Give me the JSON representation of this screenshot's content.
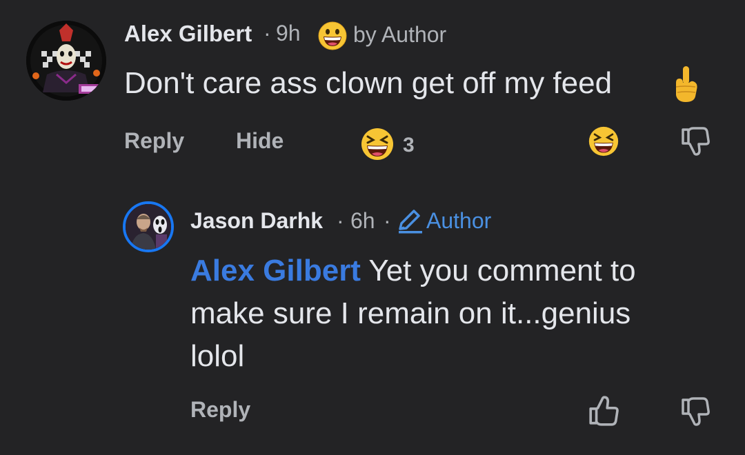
{
  "comment": {
    "author": "Alex Gilbert",
    "separator": "·",
    "time": "9h",
    "reacted_by": "by Author",
    "text": "Don't care ass clown get off my feed",
    "actions": {
      "reply": "Reply",
      "hide": "Hide"
    },
    "reaction_count": "3",
    "icons": {
      "author_reaction": "grinning-face-icon",
      "finger": "middle-finger-icon",
      "reaction_summary": "laughing-face-icon",
      "react_button": "laughing-face-icon",
      "dislike": "thumbs-down-icon"
    }
  },
  "reply": {
    "author": "Jason Darhk",
    "separator": "·",
    "time": "6h",
    "separator2": "·",
    "badge": "Author",
    "mention": "Alex Gilbert",
    "text_line1": " Yet you comment to",
    "text_line2": "make sure I remain on it...genius",
    "text_line3": "lolol",
    "actions": {
      "reply": "Reply"
    },
    "icons": {
      "badge": "pencil-icon",
      "like": "thumbs-up-icon",
      "dislike": "thumbs-down-icon"
    }
  },
  "colors": {
    "background": "#232325",
    "text": "#e4e6eb",
    "secondary_text": "#b0b3b8",
    "accent": "#1877f2",
    "mention": "#3a7be0"
  }
}
